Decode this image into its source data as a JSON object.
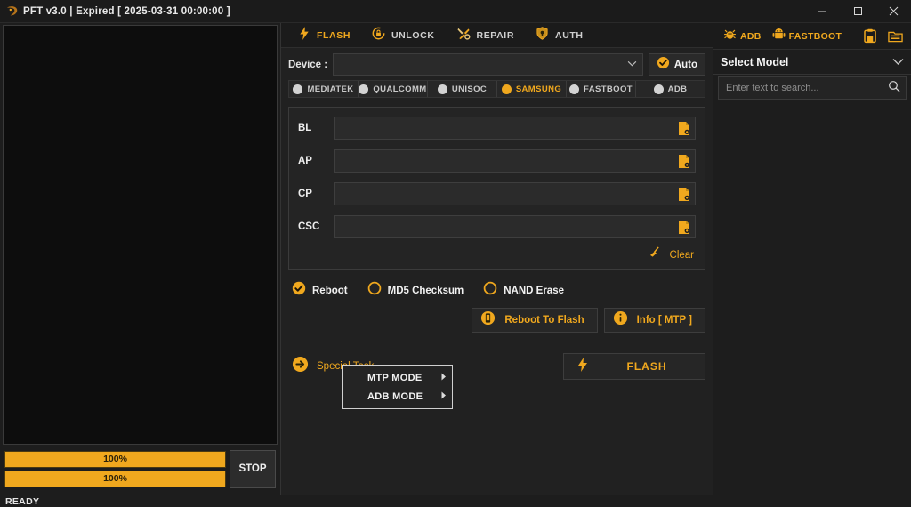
{
  "window": {
    "title": "PFT v3.0  | Expired [ 2025-03-31 00:00:00 ]",
    "logo_icon": "app-logo-icon",
    "minimize_icon": "minimize-icon",
    "maximize_icon": "maximize-icon",
    "close_icon": "close-icon"
  },
  "colors": {
    "accent": "#f0a81e",
    "panel_bg": "#212121",
    "window_bg": "#1d1d1d",
    "log_bg": "#0d0d0d",
    "progress_fill": "#f0a81e"
  },
  "log_panel": {
    "content": "",
    "progress": [
      {
        "label": "100%",
        "value": 100
      },
      {
        "label": "100%",
        "value": 100
      }
    ],
    "stop_label": "STOP"
  },
  "center": {
    "tabs": [
      {
        "label": "FLASH",
        "icon": "lightning-icon",
        "active": true
      },
      {
        "label": "UNLOCK",
        "icon": "lock-circle-icon",
        "active": false
      },
      {
        "label": "REPAIR",
        "icon": "tools-icon",
        "active": false
      },
      {
        "label": "AUTH",
        "icon": "shield-icon",
        "active": false
      }
    ],
    "device": {
      "label": "Device :",
      "value": "",
      "caret_icon": "chevron-down-icon",
      "auto_label": "Auto",
      "auto_checked": true
    },
    "chipsets": [
      {
        "label": "MEDIATEK",
        "selected": false
      },
      {
        "label": "QUALCOMM",
        "selected": false
      },
      {
        "label": "UNISOC",
        "selected": false
      },
      {
        "label": "SAMSUNG",
        "selected": true
      },
      {
        "label": "FASTBOOT",
        "selected": false
      },
      {
        "label": "ADB",
        "selected": false
      }
    ],
    "files": [
      {
        "label": "BL",
        "value": "",
        "browse_icon": "file-browse-icon"
      },
      {
        "label": "AP",
        "value": "",
        "browse_icon": "file-browse-icon"
      },
      {
        "label": "CP",
        "value": "",
        "browse_icon": "file-browse-icon"
      },
      {
        "label": "CSC",
        "value": "",
        "browse_icon": "file-browse-icon"
      }
    ],
    "clear": {
      "label": "Clear",
      "icon": "broom-icon"
    },
    "options": [
      {
        "label": "Reboot",
        "checked": true
      },
      {
        "label": "MD5 Checksum",
        "checked": false
      },
      {
        "label": "NAND Erase",
        "checked": false
      }
    ],
    "actions": [
      {
        "label": "Reboot To Flash",
        "icon": "phone-reboot-icon"
      },
      {
        "label": "Info [ MTP ]",
        "icon": "info-icon"
      }
    ],
    "special_task": {
      "label": "Special Task",
      "icon": "arrow-right-circle-icon"
    },
    "flash_button": {
      "label": "FLASH",
      "icon": "lightning-icon"
    },
    "context_menu": {
      "items": [
        {
          "label": "MTP MODE",
          "arrow_icon": "submenu-arrow-icon"
        },
        {
          "label": "ADB MODE",
          "arrow_icon": "submenu-arrow-icon"
        }
      ]
    }
  },
  "right": {
    "tools": [
      {
        "label": "ADB",
        "icon": "android-bug-icon"
      },
      {
        "label": "FASTBOOT",
        "icon": "android-robot-icon"
      }
    ],
    "icon_buttons": [
      {
        "icon": "save-clipboard-icon"
      },
      {
        "icon": "open-folder-icon"
      }
    ],
    "model_select": {
      "label": "Select Model",
      "caret_icon": "chevron-down-icon"
    },
    "search": {
      "value": "",
      "placeholder": "Enter text to search...",
      "icon": "search-icon"
    }
  },
  "status": {
    "text": "READY"
  }
}
